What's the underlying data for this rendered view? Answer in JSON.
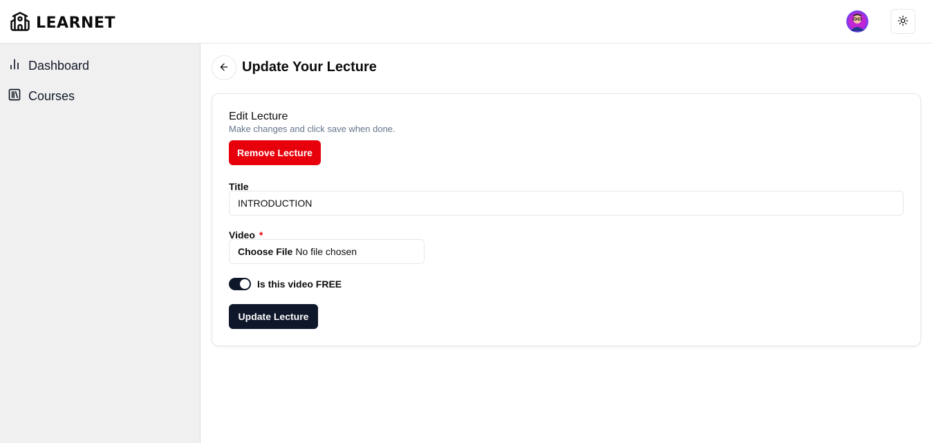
{
  "header": {
    "brand": "LEARNET",
    "logo_icon": "school-icon",
    "avatar_icon": "user-avatar",
    "theme_icon": "sun-icon"
  },
  "sidebar": {
    "items": [
      {
        "label": "Dashboard",
        "icon": "bar-chart-icon"
      },
      {
        "label": "Courses",
        "icon": "library-icon"
      }
    ]
  },
  "page": {
    "title": "Update Your Lecture",
    "back_icon": "arrow-left-icon"
  },
  "form": {
    "heading": "Edit Lecture",
    "description": "Make changes and click save when done.",
    "remove_label": "Remove Lecture",
    "title_label": "Title",
    "title_value": "INTRODUCTION",
    "video_label": "Video",
    "required_mark": "*",
    "file_button": "Choose File",
    "file_status": "No file chosen",
    "free_toggle_label": "Is this video FREE",
    "free_toggle_on": true,
    "update_label": "Update Lecture"
  },
  "colors": {
    "danger": "#e7000b",
    "primary": "#0f172a",
    "sidebar_bg": "#f0f0f0",
    "muted_text": "#64748b"
  }
}
